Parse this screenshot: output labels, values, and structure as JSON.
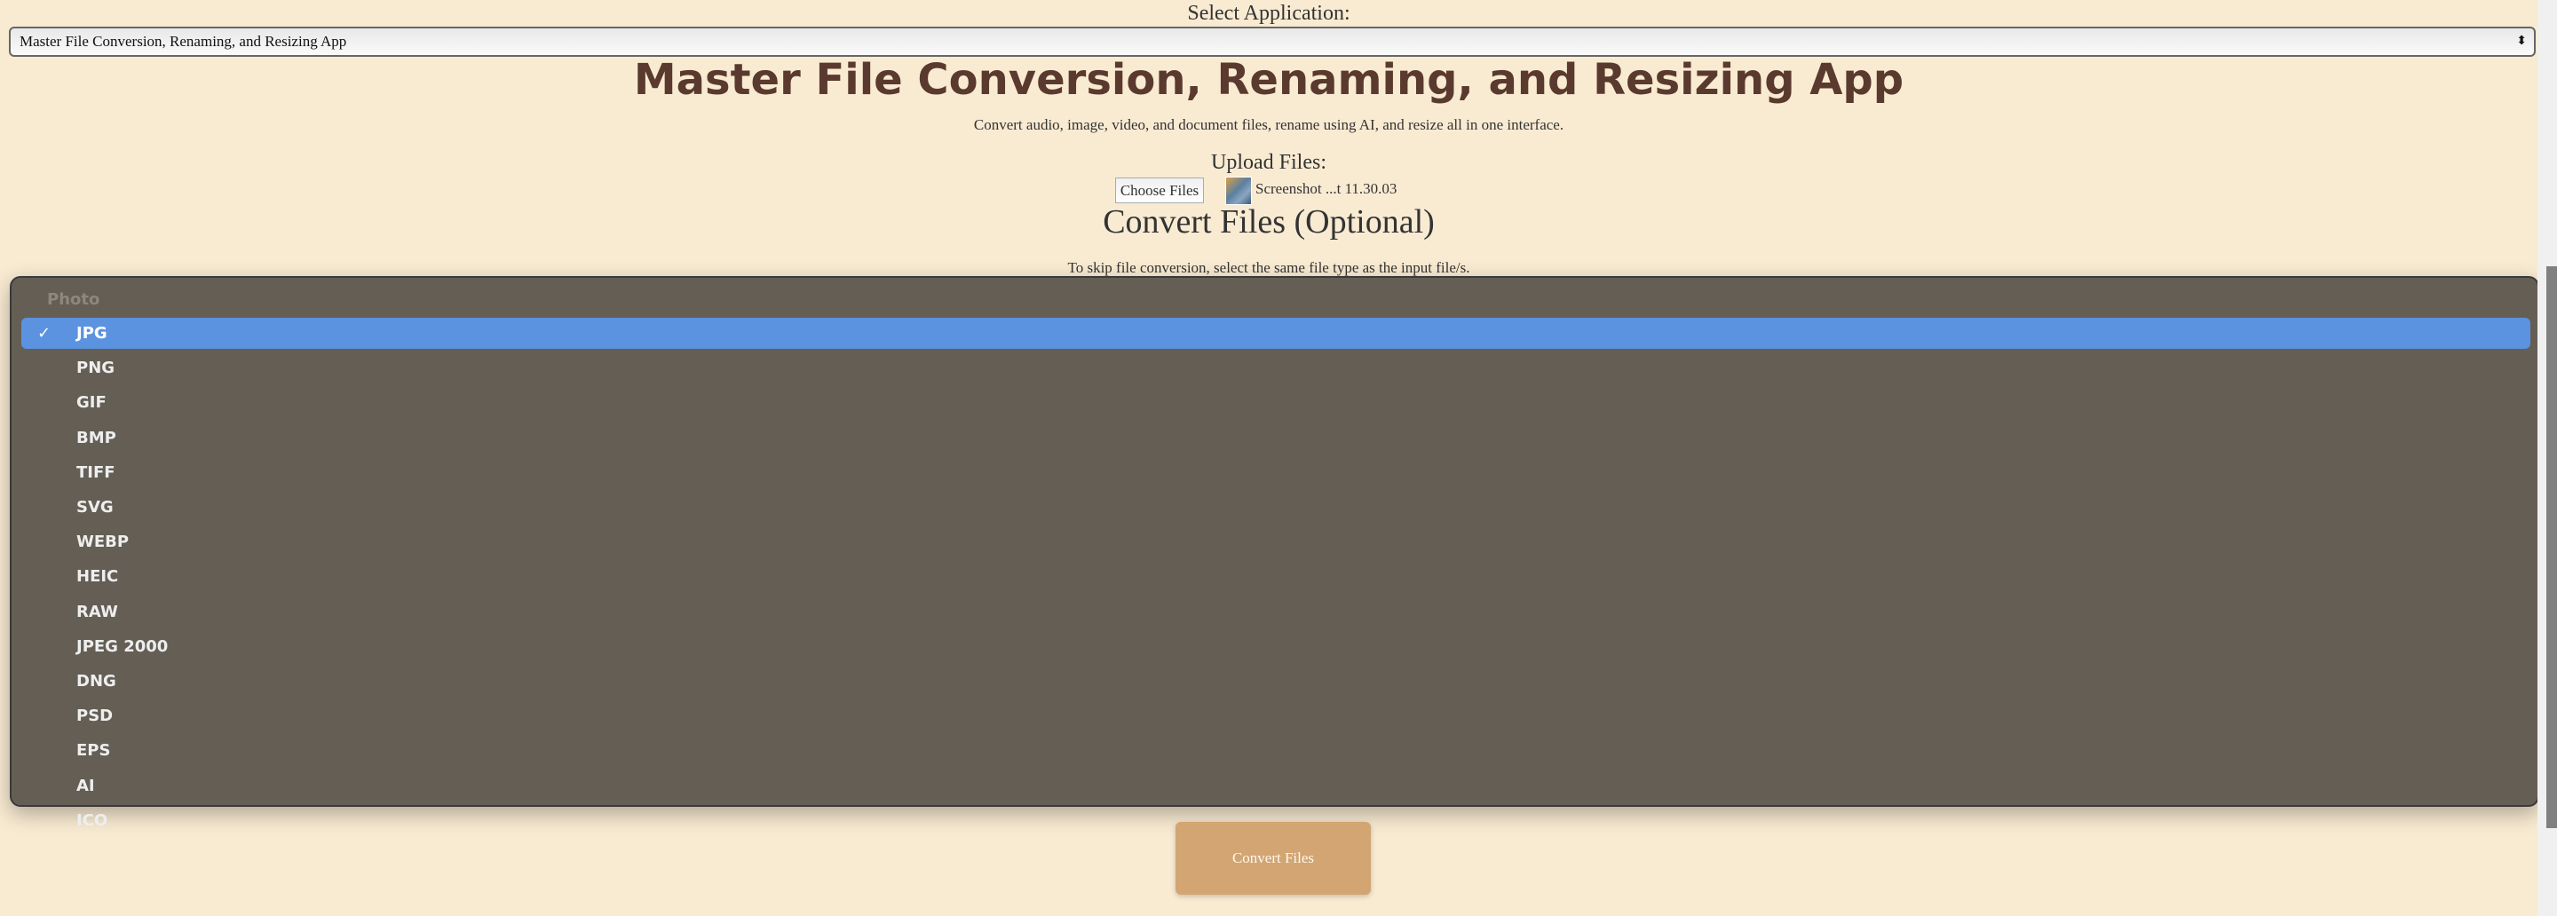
{
  "app_selector": {
    "label": "Select Application:",
    "selected": "Master File Conversion, Renaming, and Resizing App",
    "arrows": "⬍"
  },
  "header": {
    "title": "Master File Conversion, Renaming, and Resizing App",
    "subtitle": "Convert audio, image, video, and document files, rename using AI, and resize all in one interface."
  },
  "upload": {
    "label": "Upload Files:",
    "button": "Choose Files",
    "file_name": "Screenshot ...t 11.30.03"
  },
  "convert": {
    "heading": "Convert Files (Optional)",
    "hint": "To skip file conversion, select the same file type as the input file/s.",
    "button": "Convert Files"
  },
  "format_dropdown": {
    "group_label": "Photo",
    "selected": "JPG",
    "check": "✓",
    "options": [
      "JPG",
      "PNG",
      "GIF",
      "BMP",
      "TIFF",
      "SVG",
      "WEBP",
      "HEIC",
      "RAW",
      "JPEG 2000",
      "DNG",
      "PSD",
      "EPS",
      "AI",
      "ICO"
    ],
    "highlight_color": "#5b93e0"
  },
  "colors": {
    "background": "#f9ebd2",
    "title": "#5a3a2e",
    "button": "#d2a572"
  }
}
